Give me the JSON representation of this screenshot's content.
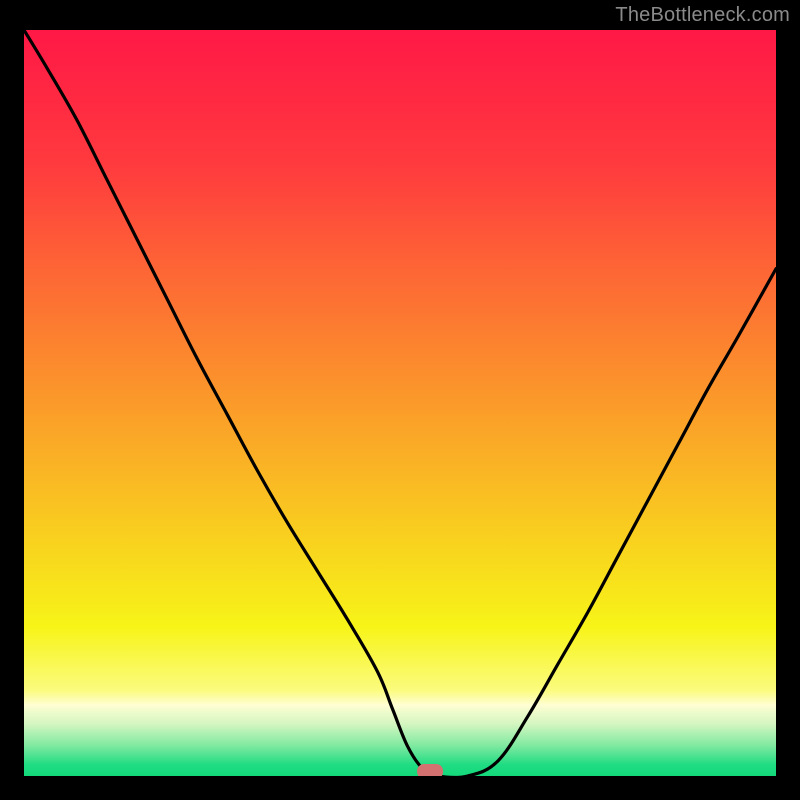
{
  "watermark": "TheBottleneck.com",
  "chart_data": {
    "type": "line",
    "title": "",
    "xlabel": "",
    "ylabel": "",
    "xlim": [
      0,
      100
    ],
    "ylim": [
      0,
      100
    ],
    "x": [
      0,
      3,
      7,
      11,
      15,
      19,
      23,
      27,
      31,
      35,
      39,
      43,
      47,
      49,
      51,
      53,
      55,
      59,
      63,
      67,
      71,
      75,
      79,
      83,
      87,
      91,
      95,
      100
    ],
    "values": [
      100,
      95,
      88,
      80,
      72,
      64,
      56,
      48.5,
      41,
      34,
      27.5,
      21,
      14,
      9,
      4,
      1,
      0,
      0,
      2,
      8,
      15,
      22,
      29.5,
      37,
      44.5,
      52,
      59,
      68
    ],
    "marker": {
      "x": 54,
      "y": 0,
      "color": "#d2716f",
      "shape": "rounded-rect"
    },
    "background": {
      "type": "vertical-gradient",
      "stops": [
        {
          "pos": 0.0,
          "color": "#ff1846"
        },
        {
          "pos": 0.18,
          "color": "#ff3a3e"
        },
        {
          "pos": 0.34,
          "color": "#fd6b34"
        },
        {
          "pos": 0.5,
          "color": "#fb9a2a"
        },
        {
          "pos": 0.66,
          "color": "#f9ca20"
        },
        {
          "pos": 0.8,
          "color": "#f7f418"
        },
        {
          "pos": 0.885,
          "color": "#fbfb7e"
        },
        {
          "pos": 0.905,
          "color": "#fefed3"
        },
        {
          "pos": 0.93,
          "color": "#d4f6c0"
        },
        {
          "pos": 0.96,
          "color": "#7de9a0"
        },
        {
          "pos": 0.985,
          "color": "#1fdc82"
        },
        {
          "pos": 1.0,
          "color": "#14d97b"
        }
      ]
    },
    "grid": false,
    "legend": false
  }
}
